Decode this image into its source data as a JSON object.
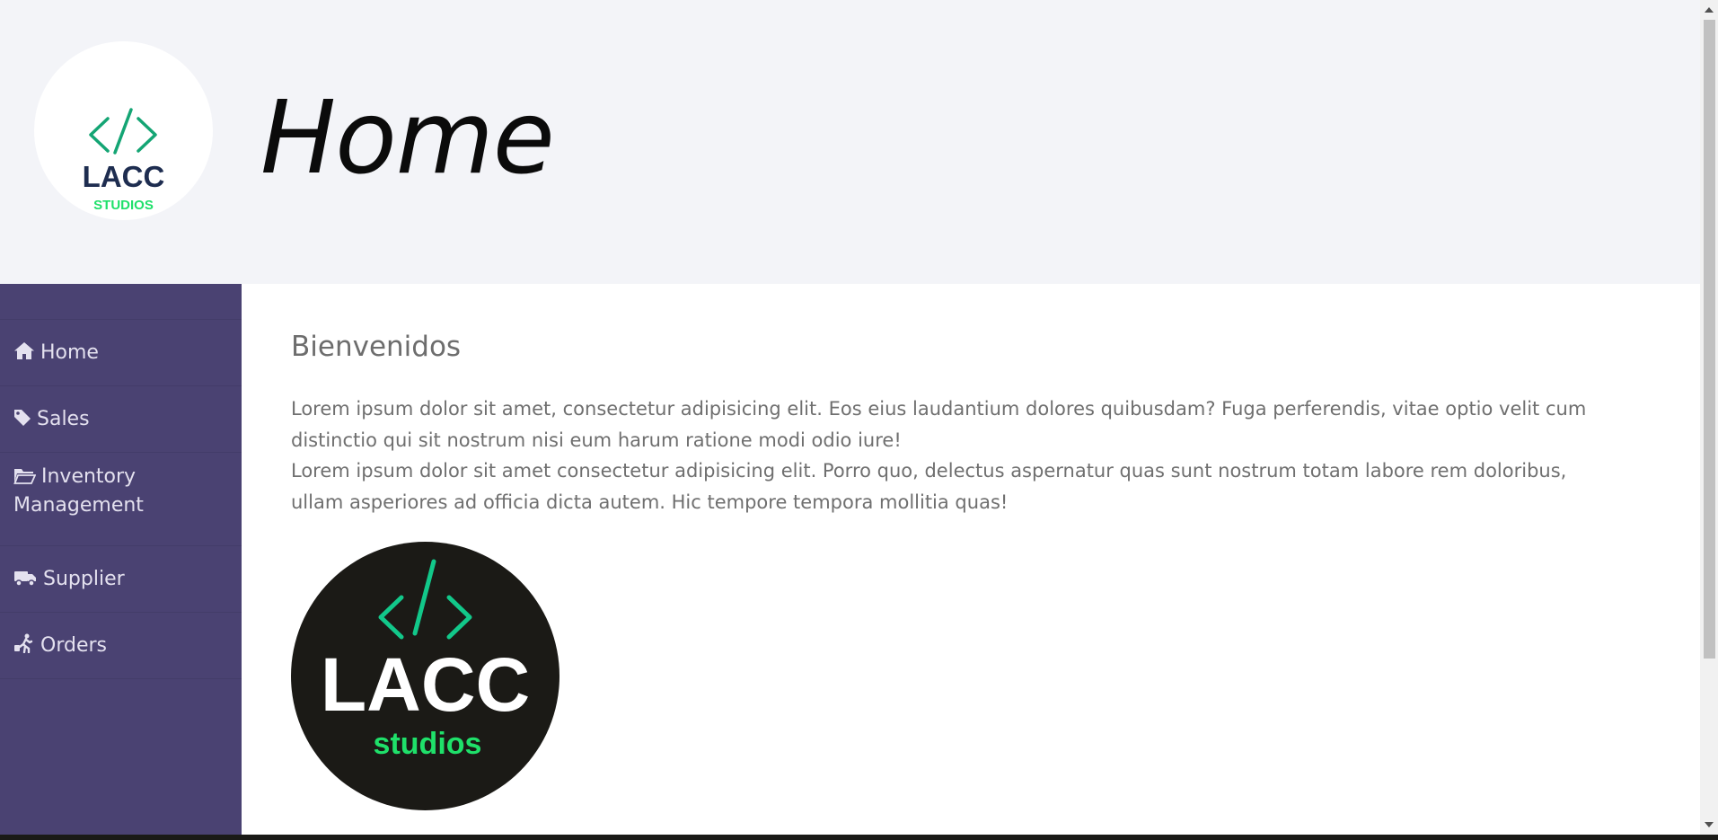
{
  "header": {
    "title": "Home",
    "logo_small": {
      "text_main": "LACC",
      "text_sub": "STUDIOS",
      "symbol": "</>"
    }
  },
  "sidebar": {
    "items": [
      {
        "label": "Home",
        "icon": "home-icon"
      },
      {
        "label": "Sales",
        "icon": "tag-icon"
      },
      {
        "label": "Inventory Management",
        "icon": "folder-open-icon"
      },
      {
        "label": "Supplier",
        "icon": "truck-icon"
      },
      {
        "label": "Orders",
        "icon": "person-walking-luggage-icon"
      }
    ]
  },
  "main": {
    "heading": "Bienvenidos",
    "paragraph_1": "Lorem ipsum dolor sit amet, consectetur adipisicing elit. Eos eius laudantium dolores quibusdam? Fuga perferendis, vitae optio velit cum distinctio qui sit nostrum nisi eum harum ratione modi odio iure!",
    "paragraph_2": "Lorem ipsum dolor sit amet consectetur adipisicing elit. Porro quo, delectus aspernatur quas sunt nostrum totam labore rem doloribus, ullam asperiores ad officia dicta autem. Hic tempore tempora mollitia quas!",
    "logo_big": {
      "text_main": "LACC",
      "text_sub": "studios",
      "symbol": "</>"
    }
  },
  "colors": {
    "sidebar_bg": "#4a4272",
    "header_bg": "#f3f4f8",
    "logo_green": "#1fe06a",
    "logo_teal": "#12b58a",
    "logo_navy": "#1e2d50"
  }
}
